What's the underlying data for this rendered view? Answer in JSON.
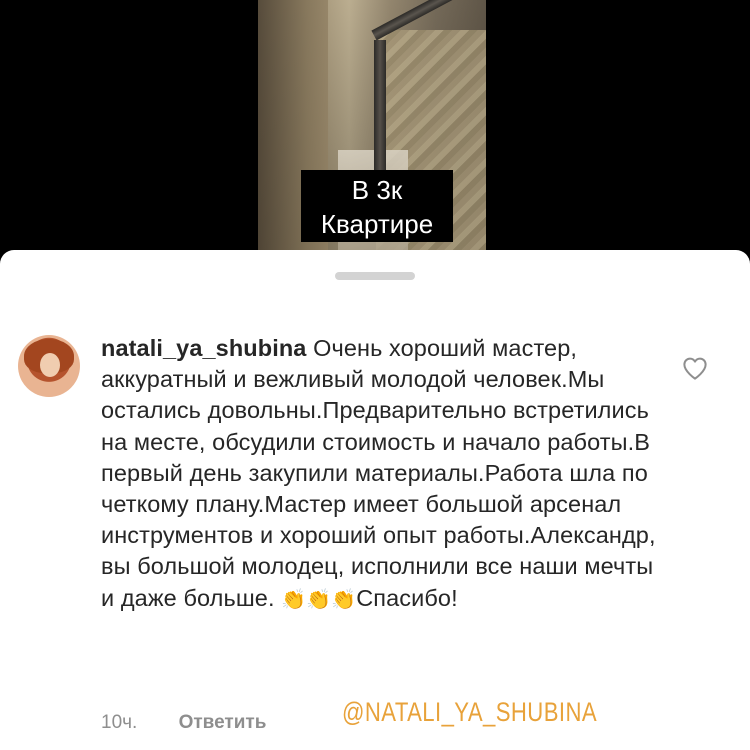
{
  "video": {
    "caption_line1": "В 3к",
    "caption_line2": "Квартире"
  },
  "comment": {
    "username": "natali_ya_shubina",
    "text_before_claps": "Очень хороший мастер, аккуратный и вежливый молодой человек.Мы остались довольны.Предварительно встретились на месте, обсудили стоимость и начало работы.В первый день закупили материалы.Работа шла по четкому плану.Мастер имеет большой арсенал инструментов и хороший опыт работы.Александр, вы большой молодец, исполнили все наши мечты и даже больше.",
    "claps": "👏👏👏",
    "text_after_claps": "Спасибо!",
    "time": "10ч.",
    "reply_label": "Ответить",
    "like_icon": "heart-outline-icon"
  },
  "watermark": "@NATALI_YA_SHUBINA",
  "colors": {
    "watermark": "#e8a23a",
    "meta_text": "#8e8e8e",
    "sheet_bg": "#ffffff"
  }
}
